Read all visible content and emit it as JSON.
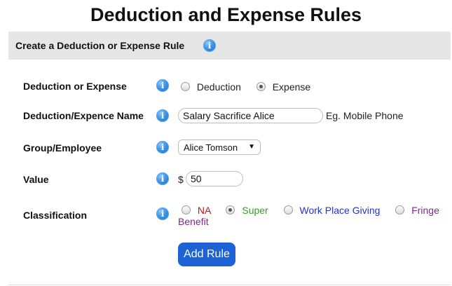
{
  "page": {
    "title": "Deduction and Expense Rules"
  },
  "section": {
    "title": "Create a Deduction or Expense Rule",
    "info_icon": "info-icon"
  },
  "form": {
    "type": {
      "label": "Deduction or Expense",
      "options": [
        {
          "label": "Deduction",
          "checked": false
        },
        {
          "label": "Expense",
          "checked": true
        }
      ]
    },
    "name": {
      "label": "Deduction/Expence Name",
      "value": "Salary Sacrifice Alice",
      "hint": "Eg. Mobile Phone"
    },
    "group": {
      "label": "Group/Employee",
      "selected": "Alice Tomson"
    },
    "value": {
      "label": "Value",
      "currency": "$",
      "amount": "50"
    },
    "classification": {
      "label": "Classification",
      "options": [
        {
          "label": "NA",
          "checked": false,
          "color": "#b21a1a"
        },
        {
          "label": "Super",
          "checked": true,
          "color": "#3a9a2a"
        },
        {
          "label": "Work Place Giving",
          "checked": false,
          "color": "#2233cc"
        },
        {
          "label": "Fringe",
          "continued": "Benefit",
          "checked": false,
          "color": "#7a2a8a"
        }
      ]
    }
  },
  "actions": {
    "add_label": "Add Rule"
  },
  "colors": {
    "accent": "#1d63d6",
    "header_bg": "#e6e6e6"
  }
}
